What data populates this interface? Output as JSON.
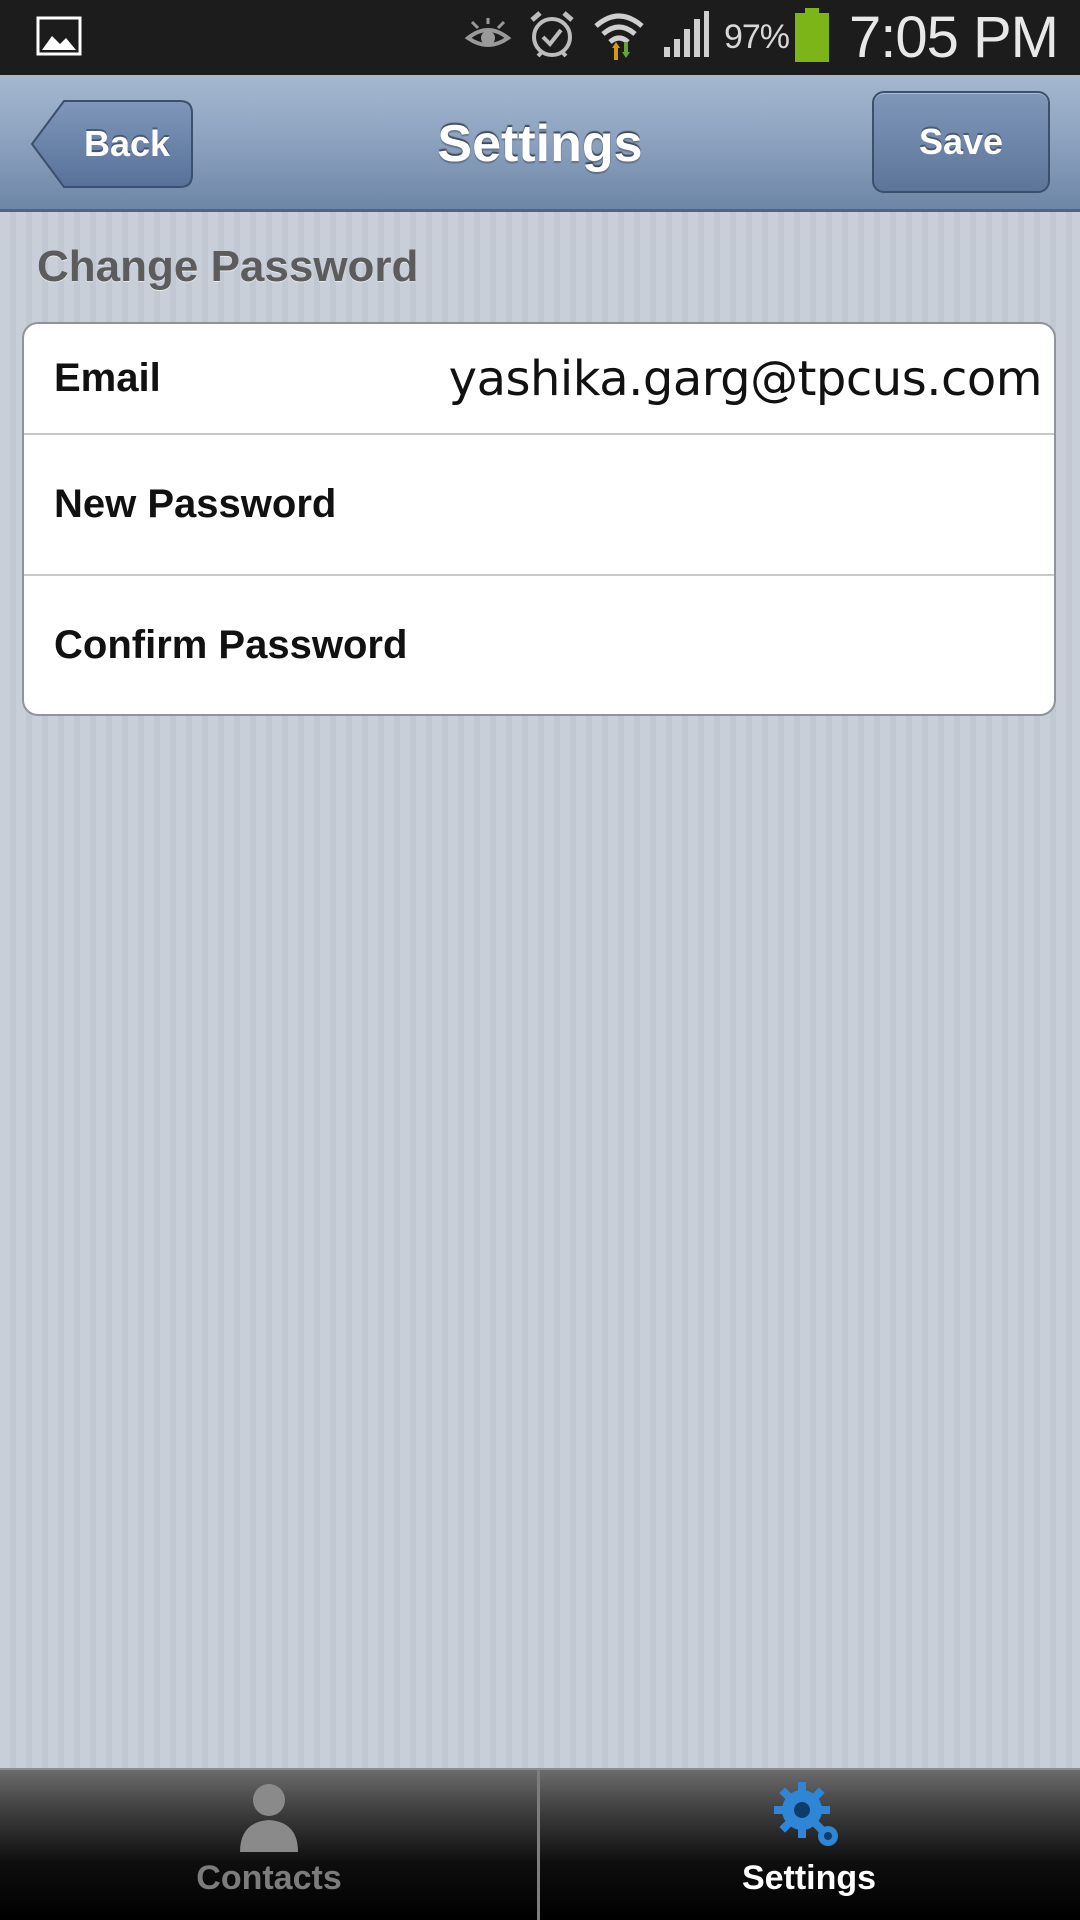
{
  "status_bar": {
    "battery_percent": "97%",
    "time": "7:05 PM",
    "icons": [
      "gallery-icon",
      "eye-icon",
      "alarm-icon",
      "wifi-icon",
      "signal-icon",
      "battery-icon"
    ],
    "battery_color": "#7cb518"
  },
  "header": {
    "back_label": "Back",
    "title": "Settings",
    "save_label": "Save"
  },
  "change_password": {
    "section_title": "Change Password",
    "email_label": "Email",
    "email_value": "yashika.garg@tpcus.com",
    "new_password_label": "New Password",
    "confirm_password_label": "Confirm Password"
  },
  "tabs": {
    "contacts_label": "Contacts",
    "settings_label": "Settings",
    "active": "Settings",
    "active_icon_color": "#2f86d6"
  }
}
